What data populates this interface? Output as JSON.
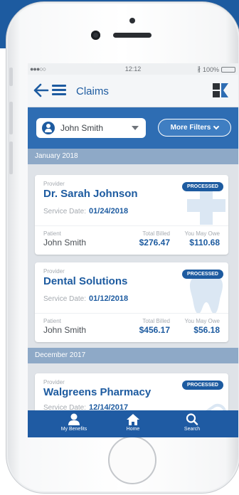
{
  "status_bar": {
    "signal": "●●●○○",
    "time": "12:12",
    "bluetooth": "∦",
    "battery": "100%"
  },
  "header": {
    "title": "Claims",
    "icons": [
      "back-arrow-icon",
      "hamburger-menu-icon",
      "logo"
    ]
  },
  "filters": {
    "selected_member": "John Smith",
    "more_filters_label": "More Filters"
  },
  "groups": [
    {
      "month": "January 2018",
      "claims": [
        {
          "provider_label": "Provider",
          "provider": "Dr. Sarah Johnson",
          "status": "PROCESSED",
          "service_label": "Service Date:",
          "service_date": "01/24/2018",
          "patient_label": "Patient",
          "patient": "John Smith",
          "total_label": "Total Billed",
          "total": "$276.47",
          "owe_label": "You May Owe",
          "owe": "$110.68",
          "icon": "medical-cross-icon"
        },
        {
          "provider_label": "Provider",
          "provider": "Dental Solutions",
          "status": "PROCESSED",
          "service_label": "Service Date:",
          "service_date": "01/12/2018",
          "patient_label": "Patient",
          "patient": "John Smith",
          "total_label": "Total Billed",
          "total": "$456.17",
          "owe_label": "You May Owe",
          "owe": "$56.18",
          "icon": "tooth-icon"
        }
      ]
    },
    {
      "month": "December 2017",
      "claims": [
        {
          "provider_label": "Provider",
          "provider": "Walgreens Pharmacy",
          "status": "PROCESSED",
          "service_label": "Service Date:",
          "service_date": "12/14/2017",
          "icon": "pill-icon"
        }
      ]
    }
  ],
  "tabs": [
    {
      "label": "My Benefits",
      "icon": "person-icon"
    },
    {
      "label": "Home",
      "icon": "home-icon"
    },
    {
      "label": "Search",
      "icon": "search-icon"
    }
  ],
  "colors": {
    "brand": "#1d5ba0",
    "filter_bar": "#2e6db3",
    "month_band": "#8ea9c7"
  }
}
